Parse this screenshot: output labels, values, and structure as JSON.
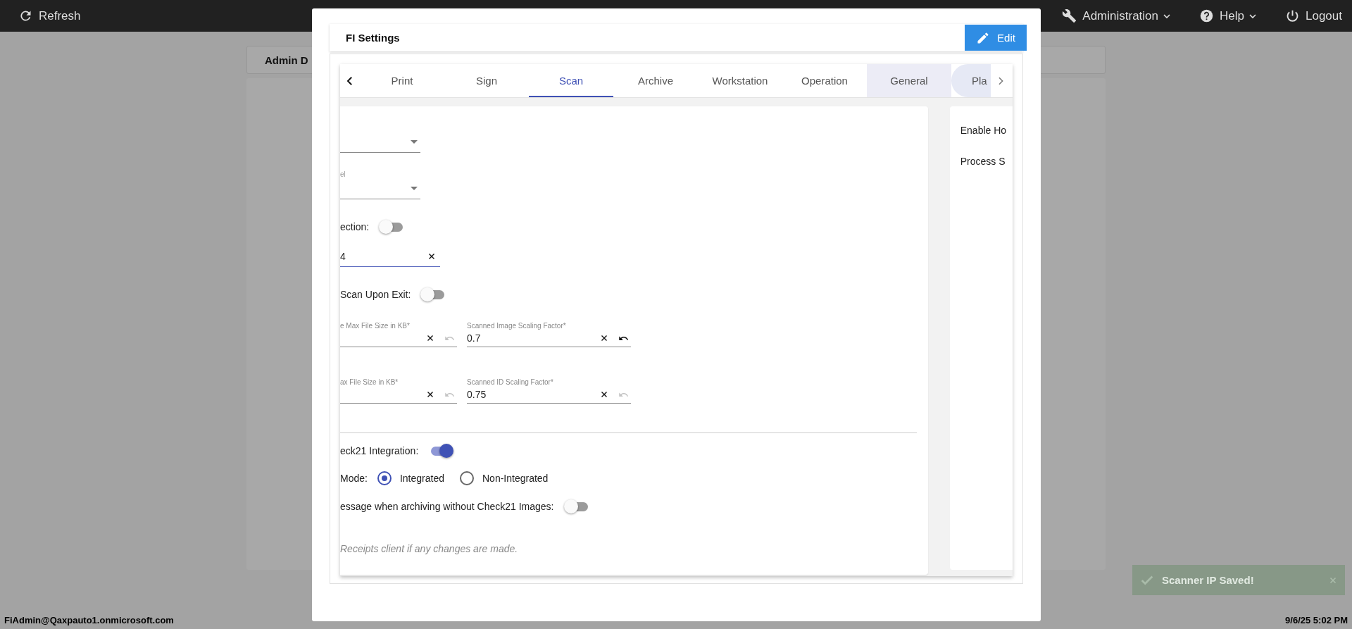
{
  "top_bar": {
    "refresh": "Refresh",
    "menus": [
      {
        "kind": "wrench",
        "label": "Administration"
      },
      {
        "kind": "help",
        "label": "Help"
      }
    ],
    "logout": "Logout"
  },
  "background": {
    "card_title": "Admin D"
  },
  "dialog": {
    "title": "FI Settings",
    "edit_button": "Edit",
    "tabs": [
      {
        "label": "Print",
        "selected": false,
        "hovered": false,
        "focused": false
      },
      {
        "label": "Sign",
        "selected": false,
        "hovered": false,
        "focused": false
      },
      {
        "label": "Scan",
        "selected": true,
        "hovered": false,
        "focused": false
      },
      {
        "label": "Archive",
        "selected": false,
        "hovered": false,
        "focused": false
      },
      {
        "label": "Workstation",
        "selected": false,
        "hovered": false,
        "focused": false
      },
      {
        "label": "Operation",
        "selected": false,
        "hovered": false,
        "focused": false
      },
      {
        "label": "General",
        "selected": false,
        "hovered": true,
        "focused": false
      },
      {
        "label": "Pla",
        "selected": false,
        "hovered": false,
        "focused": true
      }
    ],
    "sections": [
      {
        "rows": [
          {
            "kind": "dropdown"
          },
          {
            "kind": "dropdown",
            "label": "el"
          },
          {
            "kind": "toggle",
            "label": "ection:",
            "on": false
          },
          {
            "kind": "text",
            "value": "4"
          },
          {
            "kind": "toggle",
            "label": "Scan Upon Exit:",
            "on": false
          },
          {
            "kind": "pair",
            "fields": [
              {
                "label": "e Max File Size in KB*",
                "reset_enabled": false
              },
              {
                "label": "Scanned Image Scaling Factor*",
                "value": "0.7",
                "reset_enabled": true
              }
            ]
          },
          {
            "kind": "pair",
            "fields": [
              {
                "label": "ax File Size in KB*",
                "reset_enabled": false
              },
              {
                "label": "Scanned ID Scaling Factor*",
                "value": "0.75",
                "reset_enabled": false
              }
            ]
          }
        ]
      },
      {
        "rows": [
          {
            "kind": "toggle",
            "label": "eck21 Integration:",
            "on": true
          },
          {
            "kind": "radio",
            "label": "Mode:",
            "options": [
              {
                "label": "Integrated",
                "selected": true
              },
              {
                "label": "Non-Integrated",
                "selected": false
              }
            ]
          },
          {
            "kind": "toggle",
            "label": "essage when archiving without Check21 Images:",
            "on": false
          },
          {
            "kind": "note",
            "text": "Receipts client if any changes are made."
          }
        ]
      }
    ],
    "side_items": [
      "Enable Ho",
      "Process S"
    ]
  },
  "toast": {
    "message": "Scanner IP Saved!"
  },
  "status_bar": {
    "user": "FiAdmin@Qaxpauto1.onmicrosoft.com",
    "time": "9/6/25 5:02 PM"
  }
}
